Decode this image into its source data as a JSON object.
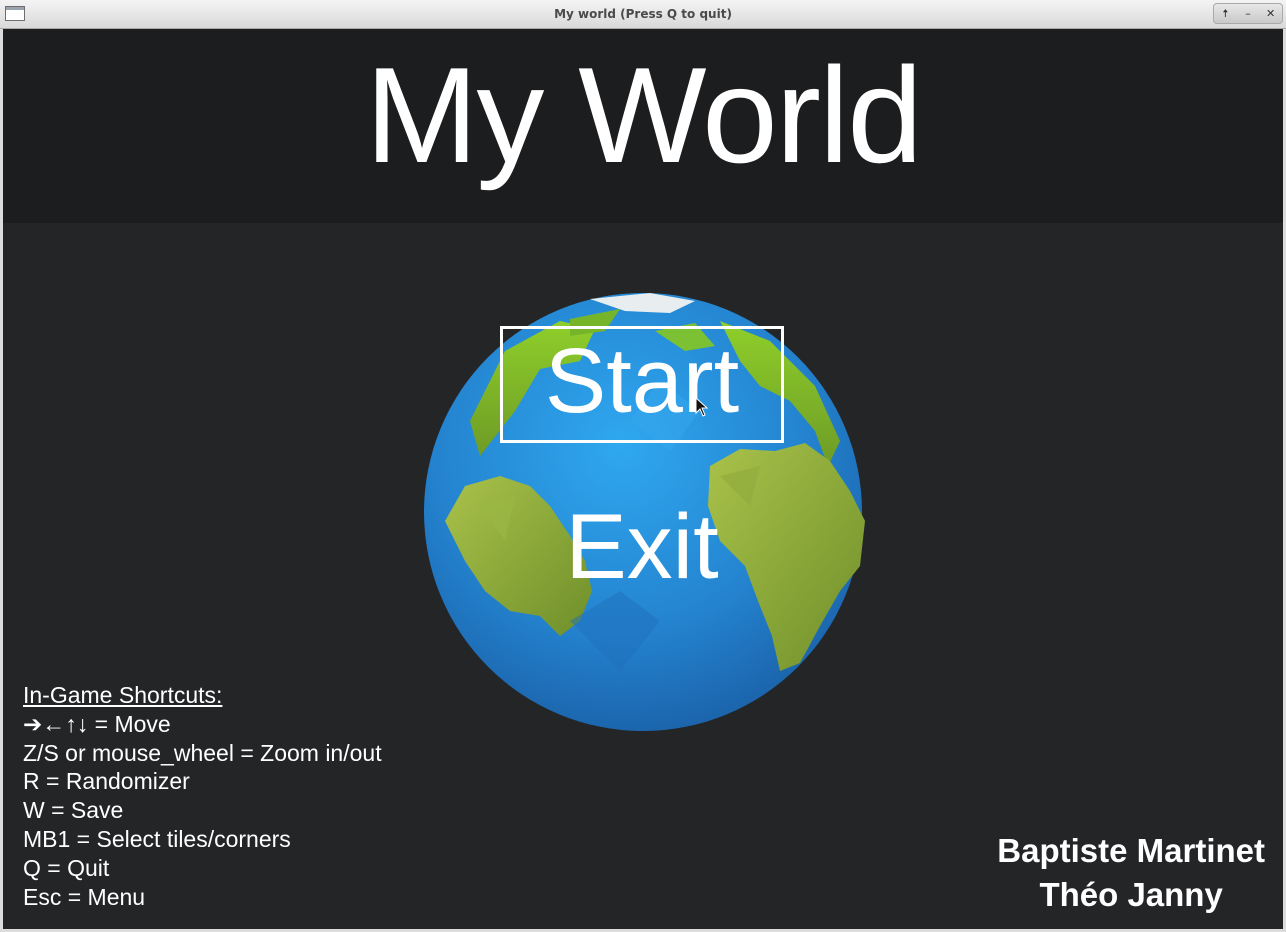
{
  "window": {
    "title": "My world (Press Q to quit)",
    "controls": {
      "maximize": "🠅",
      "minimize": "–",
      "close": "✕"
    }
  },
  "game": {
    "title": "My World",
    "menu": {
      "start_label": "Start",
      "exit_label": "Exit"
    },
    "shortcuts": {
      "heading": "In-Game Shortcuts:",
      "items": [
        "➔←↑↓ = Move",
        "Z/S or mouse_wheel = Zoom in/out",
        "R = Randomizer",
        "W = Save",
        "MB1 = Select tiles/corners",
        "Q = Quit",
        "Esc = Menu"
      ]
    },
    "credits": [
      "Baptiste Martinet",
      "Théo Janny"
    ]
  },
  "colors": {
    "background": "#242527",
    "banner": "#1c1d1e",
    "ocean": "#2a8fd9",
    "land": "#8ab62f",
    "text": "#ffffff"
  }
}
